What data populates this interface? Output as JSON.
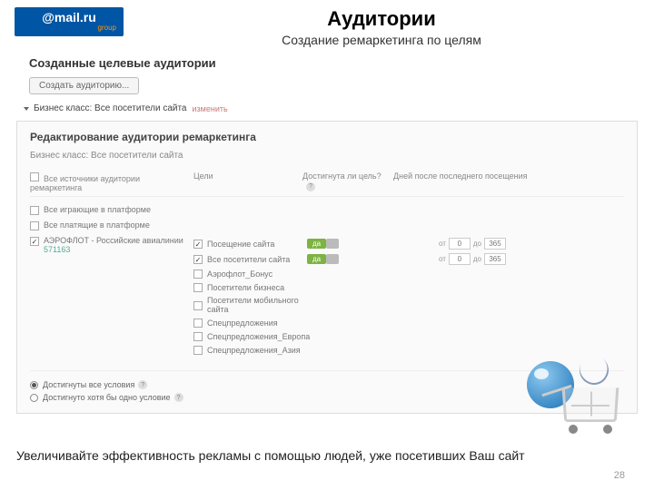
{
  "logo": {
    "brand": "@mail.ru",
    "sub": "group"
  },
  "header": {
    "title": "Аудитории",
    "subtitle": "Создание ремаркетинга по целям"
  },
  "section_title": "Созданные целевые аудитории",
  "create_btn": "Создать аудиторию...",
  "audience": {
    "name": "Бизнес класс: Все посетители сайта",
    "action": "изменить"
  },
  "panel": {
    "title": "Редактирование аудитории ремаркетинга",
    "sub": "Бизнес класс: Все посетители сайта",
    "cols": {
      "c1": "Все источники аудитории ремаркетинга",
      "c2": "Цели",
      "c3": "Достигнута ли цель?",
      "c4": "Дней после последнего посещения"
    },
    "rows": {
      "r1": "Все играющие в платформе",
      "r2": "Все платящие в платформе",
      "r3": {
        "label": "АЭРОФЛОТ - Российские авиалинии",
        "id": "571163"
      }
    },
    "goals": {
      "g1": {
        "label": "Посещение сайта",
        "badge": "да",
        "from": "0",
        "to": "365"
      },
      "g2": {
        "label": "Все посетители сайта",
        "badge": "да",
        "from": "0",
        "to": "365"
      },
      "g3": "Аэрофлот_Бонус",
      "g4": "Посетители бизнеса",
      "g5": "Посетители мобильного сайта",
      "g6": "Спецпредложения",
      "g7": "Спецпредложения_Европа",
      "g8": "Спецпредложения_Азия"
    },
    "conditions": {
      "r1": "Достигнуты все условия",
      "r2": "Достигнуто хотя бы одно условие"
    },
    "words": {
      "ot": "от",
      "do": "до"
    }
  },
  "footer": "Увеличивайте эффективность рекламы с помощью людей, уже посетивших Ваш сайт",
  "page_num": "28"
}
